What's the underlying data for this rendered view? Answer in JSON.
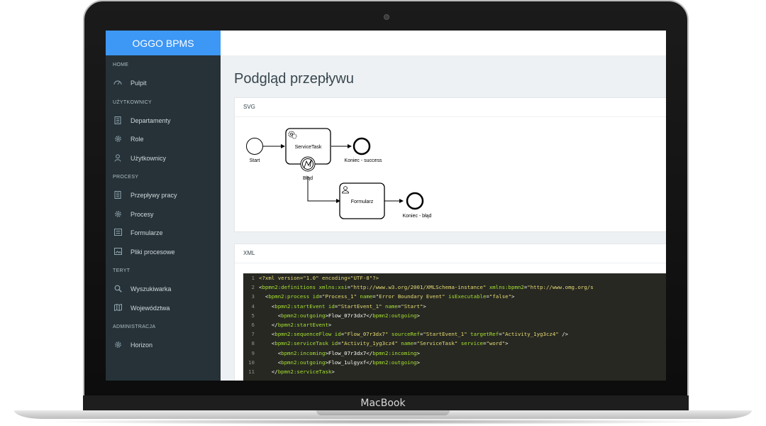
{
  "app": {
    "name": "OGGO BPMS",
    "device_label": "MacBook"
  },
  "sidebar": {
    "sections": [
      {
        "label": "HOME",
        "items": [
          {
            "label": "Pulpit",
            "icon": "dashboard-icon"
          }
        ]
      },
      {
        "label": "UŻYTKOWNICY",
        "items": [
          {
            "label": "Departamenty",
            "icon": "building-icon"
          },
          {
            "label": "Role",
            "icon": "gear-icon"
          },
          {
            "label": "Użytkownicy",
            "icon": "user-icon"
          }
        ]
      },
      {
        "label": "PROCESY",
        "items": [
          {
            "label": "Przepływy pracy",
            "icon": "building-icon"
          },
          {
            "label": "Procesy",
            "icon": "gear-icon"
          },
          {
            "label": "Formularze",
            "icon": "form-icon"
          },
          {
            "label": "Pliki procesowe",
            "icon": "image-icon"
          }
        ]
      },
      {
        "label": "TERYT",
        "items": [
          {
            "label": "Wyszukiwarka",
            "icon": "search-icon"
          },
          {
            "label": "Województwa",
            "icon": "map-icon"
          }
        ]
      },
      {
        "label": "ADMINISTRACJA",
        "items": [
          {
            "label": "Horizon",
            "icon": "gear-icon"
          }
        ]
      }
    ]
  },
  "main": {
    "title": "Podgląd przepływu",
    "svg_card": {
      "header": "SVG"
    },
    "xml_card": {
      "header": "XML"
    }
  },
  "diagram": {
    "start_label": "Start",
    "service_task_label": "ServiceTask",
    "error_label": "Błąd",
    "end_success_label": "Koniec - success",
    "form_label": "Formularz",
    "end_error_label": "Koniec - błąd"
  },
  "xml_lines": [
    {
      "n": "1",
      "segs": [
        [
          "<?xml version=\"1.0\" encoding=\"UTF-8\"?>",
          "#e6db74"
        ]
      ]
    },
    {
      "n": "2",
      "segs": [
        [
          "<",
          "#f8f8f2"
        ],
        [
          "bpmn2:definitions",
          "#a6e22e"
        ],
        [
          " xmlns:xsi",
          "#a6e22e"
        ],
        [
          "=",
          "#f8f8f2"
        ],
        [
          "\"http://www.w3.org/2001/XMLSchema-instance\"",
          "#e6db74"
        ],
        [
          " xmlns:bpmn2",
          "#a6e22e"
        ],
        [
          "=",
          "#f8f8f2"
        ],
        [
          "\"http://www.omg.org/s",
          "#e6db74"
        ]
      ]
    },
    {
      "n": "3",
      "segs": [
        [
          "  <",
          "#f8f8f2"
        ],
        [
          "bpmn2:process",
          "#a6e22e"
        ],
        [
          " id",
          "#a6e22e"
        ],
        [
          "=",
          "#f8f8f2"
        ],
        [
          "\"Process_1\"",
          "#e6db74"
        ],
        [
          " name",
          "#a6e22e"
        ],
        [
          "=",
          "#f8f8f2"
        ],
        [
          "\"Error Boundary Event\"",
          "#e6db74"
        ],
        [
          " isExecutable",
          "#a6e22e"
        ],
        [
          "=",
          "#f8f8f2"
        ],
        [
          "\"false\"",
          "#e6db74"
        ],
        [
          ">",
          "#f8f8f2"
        ]
      ]
    },
    {
      "n": "4",
      "segs": [
        [
          "    <",
          "#f8f8f2"
        ],
        [
          "bpmn2:startEvent",
          "#a6e22e"
        ],
        [
          " id",
          "#a6e22e"
        ],
        [
          "=",
          "#f8f8f2"
        ],
        [
          "\"StartEvent_1\"",
          "#e6db74"
        ],
        [
          " name",
          "#a6e22e"
        ],
        [
          "=",
          "#f8f8f2"
        ],
        [
          "\"Start\"",
          "#e6db74"
        ],
        [
          ">",
          "#f8f8f2"
        ]
      ]
    },
    {
      "n": "5",
      "segs": [
        [
          "      <",
          "#f8f8f2"
        ],
        [
          "bpmn2:outgoing",
          "#a6e22e"
        ],
        [
          ">Flow_07r3dx7</",
          "#f8f8f2"
        ],
        [
          "bpmn2:outgoing",
          "#a6e22e"
        ],
        [
          ">",
          "#f8f8f2"
        ]
      ]
    },
    {
      "n": "6",
      "segs": [
        [
          "    </",
          "#f8f8f2"
        ],
        [
          "bpmn2:startEvent",
          "#a6e22e"
        ],
        [
          ">",
          "#f8f8f2"
        ]
      ]
    },
    {
      "n": "7",
      "segs": [
        [
          "    <",
          "#f8f8f2"
        ],
        [
          "bpmn2:sequenceFlow",
          "#a6e22e"
        ],
        [
          " id",
          "#a6e22e"
        ],
        [
          "=",
          "#f8f8f2"
        ],
        [
          "\"Flow_07r3dx7\"",
          "#e6db74"
        ],
        [
          " sourceRef",
          "#a6e22e"
        ],
        [
          "=",
          "#f8f8f2"
        ],
        [
          "\"StartEvent_1\"",
          "#e6db74"
        ],
        [
          " targetRef",
          "#a6e22e"
        ],
        [
          "=",
          "#f8f8f2"
        ],
        [
          "\"Activity_1yg3cz4\"",
          "#e6db74"
        ],
        [
          " />",
          "#f8f8f2"
        ]
      ]
    },
    {
      "n": "8",
      "segs": [
        [
          "    <",
          "#f8f8f2"
        ],
        [
          "bpmn2:serviceTask",
          "#a6e22e"
        ],
        [
          " id",
          "#a6e22e"
        ],
        [
          "=",
          "#f8f8f2"
        ],
        [
          "\"Activity_1yg3cz4\"",
          "#e6db74"
        ],
        [
          " name",
          "#a6e22e"
        ],
        [
          "=",
          "#f8f8f2"
        ],
        [
          "\"ServiceTask\"",
          "#e6db74"
        ],
        [
          " service",
          "#a6e22e"
        ],
        [
          "=",
          "#f8f8f2"
        ],
        [
          "\"word\"",
          "#e6db74"
        ],
        [
          ">",
          "#f8f8f2"
        ]
      ]
    },
    {
      "n": "9",
      "segs": [
        [
          "      <",
          "#f8f8f2"
        ],
        [
          "bpmn2:incoming",
          "#a6e22e"
        ],
        [
          ">Flow_07r3dx7</",
          "#f8f8f2"
        ],
        [
          "bpmn2:incoming",
          "#a6e22e"
        ],
        [
          ">",
          "#f8f8f2"
        ]
      ]
    },
    {
      "n": "10",
      "segs": [
        [
          "      <",
          "#f8f8f2"
        ],
        [
          "bpmn2:outgoing",
          "#a6e22e"
        ],
        [
          ">Flow_1ulgyxf</",
          "#f8f8f2"
        ],
        [
          "bpmn2:outgoing",
          "#a6e22e"
        ],
        [
          ">",
          "#f8f8f2"
        ]
      ]
    },
    {
      "n": "11",
      "segs": [
        [
          "    </",
          "#f8f8f2"
        ],
        [
          "bpmn2:serviceTask",
          "#a6e22e"
        ],
        [
          ">",
          "#f8f8f2"
        ]
      ]
    }
  ],
  "colors": {
    "accent": "#3d97f4",
    "sidebar_bg": "#263238",
    "code_bg": "#272822"
  }
}
